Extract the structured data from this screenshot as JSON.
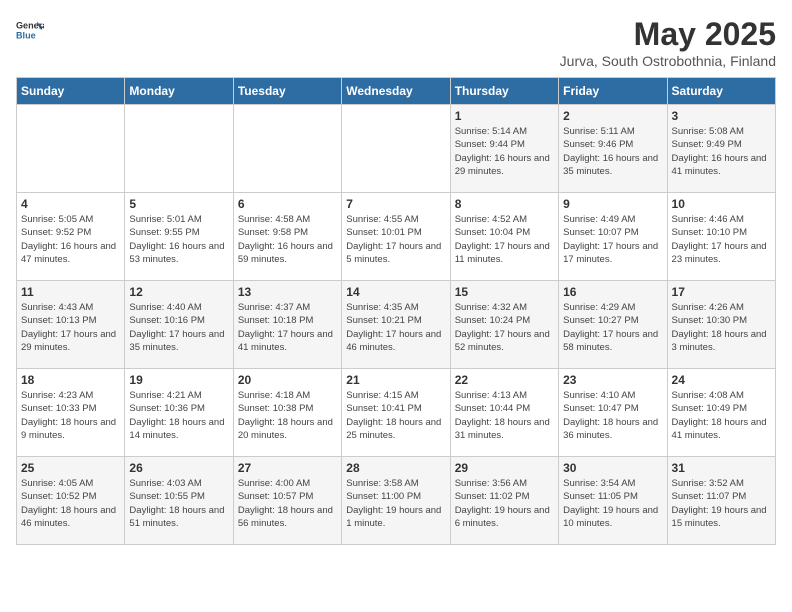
{
  "header": {
    "logo_general": "General",
    "logo_blue": "Blue",
    "title": "May 2025",
    "location": "Jurva, South Ostrobothnia, Finland"
  },
  "weekdays": [
    "Sunday",
    "Monday",
    "Tuesday",
    "Wednesday",
    "Thursday",
    "Friday",
    "Saturday"
  ],
  "weeks": [
    [
      {
        "day": "",
        "sunrise": "",
        "sunset": "",
        "daylight": ""
      },
      {
        "day": "",
        "sunrise": "",
        "sunset": "",
        "daylight": ""
      },
      {
        "day": "",
        "sunrise": "",
        "sunset": "",
        "daylight": ""
      },
      {
        "day": "",
        "sunrise": "",
        "sunset": "",
        "daylight": ""
      },
      {
        "day": "1",
        "sunrise": "Sunrise: 5:14 AM",
        "sunset": "Sunset: 9:44 PM",
        "daylight": "Daylight: 16 hours and 29 minutes."
      },
      {
        "day": "2",
        "sunrise": "Sunrise: 5:11 AM",
        "sunset": "Sunset: 9:46 PM",
        "daylight": "Daylight: 16 hours and 35 minutes."
      },
      {
        "day": "3",
        "sunrise": "Sunrise: 5:08 AM",
        "sunset": "Sunset: 9:49 PM",
        "daylight": "Daylight: 16 hours and 41 minutes."
      }
    ],
    [
      {
        "day": "4",
        "sunrise": "Sunrise: 5:05 AM",
        "sunset": "Sunset: 9:52 PM",
        "daylight": "Daylight: 16 hours and 47 minutes."
      },
      {
        "day": "5",
        "sunrise": "Sunrise: 5:01 AM",
        "sunset": "Sunset: 9:55 PM",
        "daylight": "Daylight: 16 hours and 53 minutes."
      },
      {
        "day": "6",
        "sunrise": "Sunrise: 4:58 AM",
        "sunset": "Sunset: 9:58 PM",
        "daylight": "Daylight: 16 hours and 59 minutes."
      },
      {
        "day": "7",
        "sunrise": "Sunrise: 4:55 AM",
        "sunset": "Sunset: 10:01 PM",
        "daylight": "Daylight: 17 hours and 5 minutes."
      },
      {
        "day": "8",
        "sunrise": "Sunrise: 4:52 AM",
        "sunset": "Sunset: 10:04 PM",
        "daylight": "Daylight: 17 hours and 11 minutes."
      },
      {
        "day": "9",
        "sunrise": "Sunrise: 4:49 AM",
        "sunset": "Sunset: 10:07 PM",
        "daylight": "Daylight: 17 hours and 17 minutes."
      },
      {
        "day": "10",
        "sunrise": "Sunrise: 4:46 AM",
        "sunset": "Sunset: 10:10 PM",
        "daylight": "Daylight: 17 hours and 23 minutes."
      }
    ],
    [
      {
        "day": "11",
        "sunrise": "Sunrise: 4:43 AM",
        "sunset": "Sunset: 10:13 PM",
        "daylight": "Daylight: 17 hours and 29 minutes."
      },
      {
        "day": "12",
        "sunrise": "Sunrise: 4:40 AM",
        "sunset": "Sunset: 10:16 PM",
        "daylight": "Daylight: 17 hours and 35 minutes."
      },
      {
        "day": "13",
        "sunrise": "Sunrise: 4:37 AM",
        "sunset": "Sunset: 10:18 PM",
        "daylight": "Daylight: 17 hours and 41 minutes."
      },
      {
        "day": "14",
        "sunrise": "Sunrise: 4:35 AM",
        "sunset": "Sunset: 10:21 PM",
        "daylight": "Daylight: 17 hours and 46 minutes."
      },
      {
        "day": "15",
        "sunrise": "Sunrise: 4:32 AM",
        "sunset": "Sunset: 10:24 PM",
        "daylight": "Daylight: 17 hours and 52 minutes."
      },
      {
        "day": "16",
        "sunrise": "Sunrise: 4:29 AM",
        "sunset": "Sunset: 10:27 PM",
        "daylight": "Daylight: 17 hours and 58 minutes."
      },
      {
        "day": "17",
        "sunrise": "Sunrise: 4:26 AM",
        "sunset": "Sunset: 10:30 PM",
        "daylight": "Daylight: 18 hours and 3 minutes."
      }
    ],
    [
      {
        "day": "18",
        "sunrise": "Sunrise: 4:23 AM",
        "sunset": "Sunset: 10:33 PM",
        "daylight": "Daylight: 18 hours and 9 minutes."
      },
      {
        "day": "19",
        "sunrise": "Sunrise: 4:21 AM",
        "sunset": "Sunset: 10:36 PM",
        "daylight": "Daylight: 18 hours and 14 minutes."
      },
      {
        "day": "20",
        "sunrise": "Sunrise: 4:18 AM",
        "sunset": "Sunset: 10:38 PM",
        "daylight": "Daylight: 18 hours and 20 minutes."
      },
      {
        "day": "21",
        "sunrise": "Sunrise: 4:15 AM",
        "sunset": "Sunset: 10:41 PM",
        "daylight": "Daylight: 18 hours and 25 minutes."
      },
      {
        "day": "22",
        "sunrise": "Sunrise: 4:13 AM",
        "sunset": "Sunset: 10:44 PM",
        "daylight": "Daylight: 18 hours and 31 minutes."
      },
      {
        "day": "23",
        "sunrise": "Sunrise: 4:10 AM",
        "sunset": "Sunset: 10:47 PM",
        "daylight": "Daylight: 18 hours and 36 minutes."
      },
      {
        "day": "24",
        "sunrise": "Sunrise: 4:08 AM",
        "sunset": "Sunset: 10:49 PM",
        "daylight": "Daylight: 18 hours and 41 minutes."
      }
    ],
    [
      {
        "day": "25",
        "sunrise": "Sunrise: 4:05 AM",
        "sunset": "Sunset: 10:52 PM",
        "daylight": "Daylight: 18 hours and 46 minutes."
      },
      {
        "day": "26",
        "sunrise": "Sunrise: 4:03 AM",
        "sunset": "Sunset: 10:55 PM",
        "daylight": "Daylight: 18 hours and 51 minutes."
      },
      {
        "day": "27",
        "sunrise": "Sunrise: 4:00 AM",
        "sunset": "Sunset: 10:57 PM",
        "daylight": "Daylight: 18 hours and 56 minutes."
      },
      {
        "day": "28",
        "sunrise": "Sunrise: 3:58 AM",
        "sunset": "Sunset: 11:00 PM",
        "daylight": "Daylight: 19 hours and 1 minute."
      },
      {
        "day": "29",
        "sunrise": "Sunrise: 3:56 AM",
        "sunset": "Sunset: 11:02 PM",
        "daylight": "Daylight: 19 hours and 6 minutes."
      },
      {
        "day": "30",
        "sunrise": "Sunrise: 3:54 AM",
        "sunset": "Sunset: 11:05 PM",
        "daylight": "Daylight: 19 hours and 10 minutes."
      },
      {
        "day": "31",
        "sunrise": "Sunrise: 3:52 AM",
        "sunset": "Sunset: 11:07 PM",
        "daylight": "Daylight: 19 hours and 15 minutes."
      }
    ]
  ]
}
